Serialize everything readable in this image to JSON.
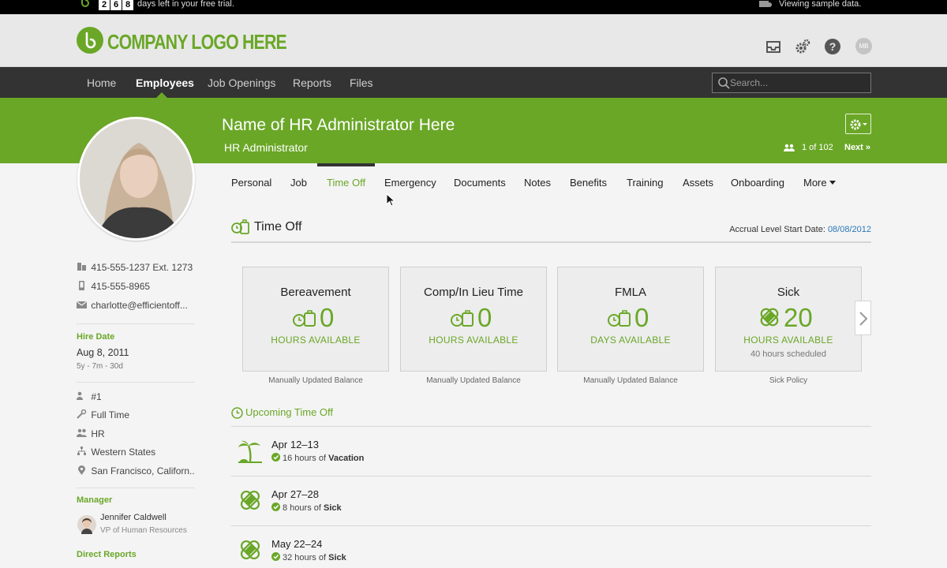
{
  "trial_bar": {
    "days_digits": [
      "2",
      "6",
      "8"
    ],
    "days_text": "days left in your free trial.",
    "sample_text": "Viewing sample data."
  },
  "header": {
    "logo_text": "COMPANY LOGO HERE",
    "icons": [
      "inbox-icon",
      "settings-gear-icon",
      "help-icon"
    ],
    "user_initials": "MB"
  },
  "nav": {
    "items": [
      "Home",
      "Employees",
      "Job Openings",
      "Reports",
      "Files"
    ],
    "active": "Employees",
    "search_placeholder": "Search..."
  },
  "employee": {
    "name": "Name of HR Administrator Here",
    "title": "HR Administrator",
    "pager": "1 of 102",
    "next_label": "Next »"
  },
  "sidebar": {
    "work_phone": "415-555-1237",
    "work_ext": "Ext. 1273",
    "mobile_phone": "415-555-8965",
    "email": "charlotte@efficientoff...",
    "hire_date_label": "Hire Date",
    "hire_date": "Aug 8, 2011",
    "tenure": "5y - 7m - 30d",
    "employee_number": "#1",
    "employment_type": "Full Time",
    "department": "HR",
    "division": "Western States",
    "location": "San Francisco, Californ..",
    "manager_label": "Manager",
    "manager_name": "Jennifer Caldwell",
    "manager_title": "VP of Human Resources",
    "direct_reports_label": "Direct Reports"
  },
  "tabs": {
    "items": [
      "Personal",
      "Job",
      "Time Off",
      "Emergency",
      "Documents",
      "Notes",
      "Benefits",
      "Training",
      "Assets",
      "Onboarding",
      "More"
    ],
    "active": "Time Off"
  },
  "time_off": {
    "title": "Time Off",
    "accrual_label": "Accrual Level Start Date:",
    "accrual_date": "08/08/2012",
    "cards": [
      {
        "name": "Bereavement",
        "value": "0",
        "unit": "HOURS AVAILABLE",
        "scheduled": "",
        "footer": "Manually Updated Balance",
        "icon": "timeoff-bag-icon"
      },
      {
        "name": "Comp/In Lieu Time",
        "value": "0",
        "unit": "HOURS AVAILABLE",
        "scheduled": "",
        "footer": "Manually Updated Balance",
        "icon": "timeoff-bag-icon"
      },
      {
        "name": "FMLA",
        "value": "0",
        "unit": "DAYS AVAILABLE",
        "scheduled": "",
        "footer": "Manually Updated Balance",
        "icon": "timeoff-bag-icon"
      },
      {
        "name": "Sick",
        "value": "20",
        "unit": "HOURS AVAILABLE",
        "scheduled": "40 hours scheduled",
        "footer": "Sick Policy",
        "icon": "bandage-icon"
      }
    ]
  },
  "upcoming": {
    "title": "Upcoming Time Off",
    "items": [
      {
        "dates": "Apr 12–13",
        "hours": "16 hours of",
        "type": "Vacation",
        "icon": "palm-tree-icon"
      },
      {
        "dates": "Apr 27–28",
        "hours": "8 hours of",
        "type": "Sick",
        "icon": "bandage-icon"
      },
      {
        "dates": "May 22–24",
        "hours": "32 hours of",
        "type": "Sick",
        "icon": "bandage-icon"
      }
    ]
  },
  "colors": {
    "brand_green": "#6aa727",
    "nav_dark": "#333333",
    "link_blue": "#2a77b7"
  }
}
